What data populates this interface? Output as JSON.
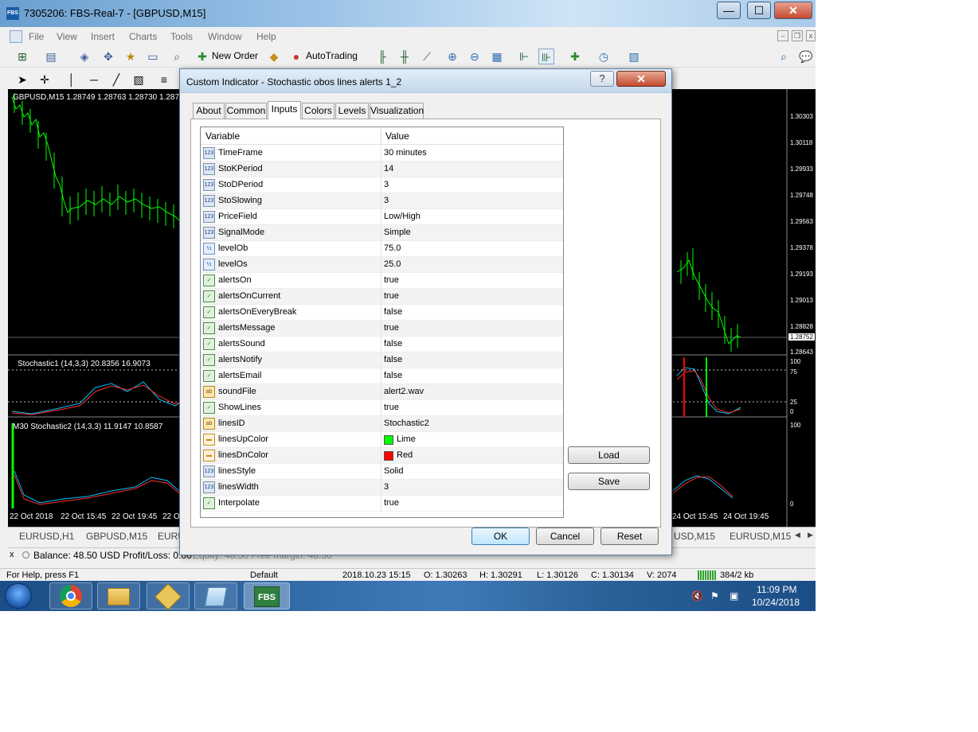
{
  "window": {
    "title": "7305206: FBS-Real-7 - [GBPUSD,M15]",
    "app_icon": "FBS",
    "min_label": "—",
    "max_label": "☐",
    "close_label": "✕"
  },
  "menu": [
    "File",
    "View",
    "Insert",
    "Charts",
    "Tools",
    "Window",
    "Help"
  ],
  "toolbar": {
    "new_order": "New Order",
    "autotrading": "AutoTrading"
  },
  "charts": {
    "main_label": "GBPUSD,M15  1.28749 1.28763 1.28730 1.287",
    "stoch1_label": "Stochastic1  (14,3,3) 20.8356 16.9073",
    "stoch2_label": "M30   Stochastic2  (14,3,3) 11.9147 10.8587",
    "price_axis": [
      "1.30303",
      "1.30118",
      "1.29933",
      "1.29748",
      "1.29563",
      "1.29378",
      "1.29193",
      "1.29013",
      "1.28828",
      "1.28752",
      "1.28643"
    ],
    "stoch1_axis": [
      "100",
      "75",
      "25",
      "0"
    ],
    "stoch2_axis": [
      "100",
      "0"
    ],
    "time_axis_left": [
      "22 Oct 2018",
      "22 Oct 15:45",
      "22 Oct 19:45",
      "22 Oc"
    ],
    "time_axis_right": [
      "24 Oct 15:45",
      "24 Oct 19:45"
    ],
    "tabs": [
      "EURUSD,H1",
      "GBPUSD,M15",
      "EURU",
      "USD,M15",
      "EURUSD,M15"
    ]
  },
  "terminal": {
    "balance": "Balance: 48.50 USD  Profit/Loss: 0.00",
    "equity_partial": "Equity: 48.50  Free margin: 48.50"
  },
  "statusbar": {
    "help": "For Help, press F1",
    "profile": "Default",
    "datetime": "2018.10.23 15:15",
    "open": "O: 1.30263",
    "high": "H: 1.30291",
    "low": "L: 1.30126",
    "close": "C: 1.30134",
    "volume": "V: 2074",
    "traffic": "384/2 kb"
  },
  "taskbar": {
    "time": "11:09 PM",
    "date": "10/24/2018",
    "fbs_label": "FBS"
  },
  "dialog": {
    "title": "Custom Indicator - Stochastic obos lines alerts 1_2",
    "help_label": "?",
    "close_label": "✕",
    "tabs": [
      "About",
      "Common",
      "Inputs",
      "Colors",
      "Levels",
      "Visualization"
    ],
    "active_tab": "Inputs",
    "columns": [
      "Variable",
      "Value"
    ],
    "rows": [
      {
        "type": "int",
        "icon": "123",
        "name": "TimeFrame",
        "value": "30 minutes"
      },
      {
        "type": "int",
        "icon": "123",
        "name": "StoKPeriod",
        "value": "14"
      },
      {
        "type": "int",
        "icon": "123",
        "name": "StoDPeriod",
        "value": "3"
      },
      {
        "type": "int",
        "icon": "123",
        "name": "StoSlowing",
        "value": "3"
      },
      {
        "type": "int",
        "icon": "123",
        "name": "PriceField",
        "value": "Low/High"
      },
      {
        "type": "int",
        "icon": "123",
        "name": "SignalMode",
        "value": "Simple"
      },
      {
        "type": "dbl",
        "icon": "½",
        "name": "levelOb",
        "value": "75.0"
      },
      {
        "type": "dbl",
        "icon": "½",
        "name": "levelOs",
        "value": "25.0"
      },
      {
        "type": "bool",
        "icon": "✓",
        "name": "alertsOn",
        "value": "true"
      },
      {
        "type": "bool",
        "icon": "✓",
        "name": "alertsOnCurrent",
        "value": "true"
      },
      {
        "type": "bool",
        "icon": "✓",
        "name": "alertsOnEveryBreak",
        "value": "false"
      },
      {
        "type": "bool",
        "icon": "✓",
        "name": "alertsMessage",
        "value": "true"
      },
      {
        "type": "bool",
        "icon": "✓",
        "name": "alertsSound",
        "value": "false"
      },
      {
        "type": "bool",
        "icon": "✓",
        "name": "alertsNotify",
        "value": "false"
      },
      {
        "type": "bool",
        "icon": "✓",
        "name": "alertsEmail",
        "value": "false"
      },
      {
        "type": "str",
        "icon": "ab",
        "name": "soundFile",
        "value": "alert2.wav"
      },
      {
        "type": "bool",
        "icon": "✓",
        "name": "ShowLines",
        "value": "true"
      },
      {
        "type": "str",
        "icon": "ab",
        "name": "linesID",
        "value": " Stochastic2"
      },
      {
        "type": "col",
        "icon": "▬",
        "name": "linesUpColor",
        "value": "Lime",
        "swatch": "#00ff00"
      },
      {
        "type": "col",
        "icon": "▬",
        "name": "linesDnColor",
        "value": "Red",
        "swatch": "#ff0000"
      },
      {
        "type": "int",
        "icon": "123",
        "name": "linesStyle",
        "value": "Solid"
      },
      {
        "type": "int",
        "icon": "123",
        "name": "linesWidth",
        "value": "3"
      },
      {
        "type": "bool",
        "icon": "✓",
        "name": "Interpolate",
        "value": "true"
      }
    ],
    "buttons": {
      "load": "Load",
      "save": "Save",
      "ok": "OK",
      "cancel": "Cancel",
      "reset": "Reset"
    }
  }
}
